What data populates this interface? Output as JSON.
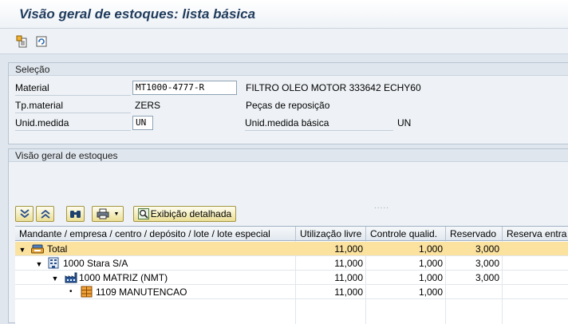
{
  "title": "Visão geral de estoques: lista básica",
  "toolbar": {
    "icons": [
      "new-selection-icon",
      "refresh-icon"
    ]
  },
  "selection": {
    "header": "Seleção",
    "material_label": "Material",
    "material_value": "MT1000-4777-R",
    "material_desc": "FILTRO OLEO MOTOR 333642 ECHY60",
    "type_label": "Tp.material",
    "type_value": "ZERS",
    "type_desc": "Peças de reposição",
    "unit_label": "Unid.medida",
    "unit_value": "UN",
    "base_unit_label": "Unid.medida básica",
    "base_unit_value": "UN"
  },
  "overview": {
    "header": "Visão geral de estoques",
    "grip": ".....",
    "detail_button": "Exibição detalhada",
    "columns": [
      "Mandante / empresa / centro / depósito / lote / lote especial",
      "Utilização livre",
      "Controle qualid.",
      "Reservado",
      "Reserva entra"
    ],
    "rows": [
      {
        "label": "Total",
        "free": "11,000",
        "qc": "1,000",
        "reserved": "3,000",
        "icon": "total-icon"
      },
      {
        "label": "1000 Stara S/A",
        "free": "11,000",
        "qc": "1,000",
        "reserved": "3,000",
        "icon": "company-icon"
      },
      {
        "label": "1000 MATRIZ (NMT)",
        "free": "11,000",
        "qc": "1,000",
        "reserved": "3,000",
        "icon": "plant-icon"
      },
      {
        "label": "1109 MANUTENCAO",
        "free": "11,000",
        "qc": "1,000",
        "reserved": "",
        "icon": "storage-location-icon"
      }
    ]
  }
}
